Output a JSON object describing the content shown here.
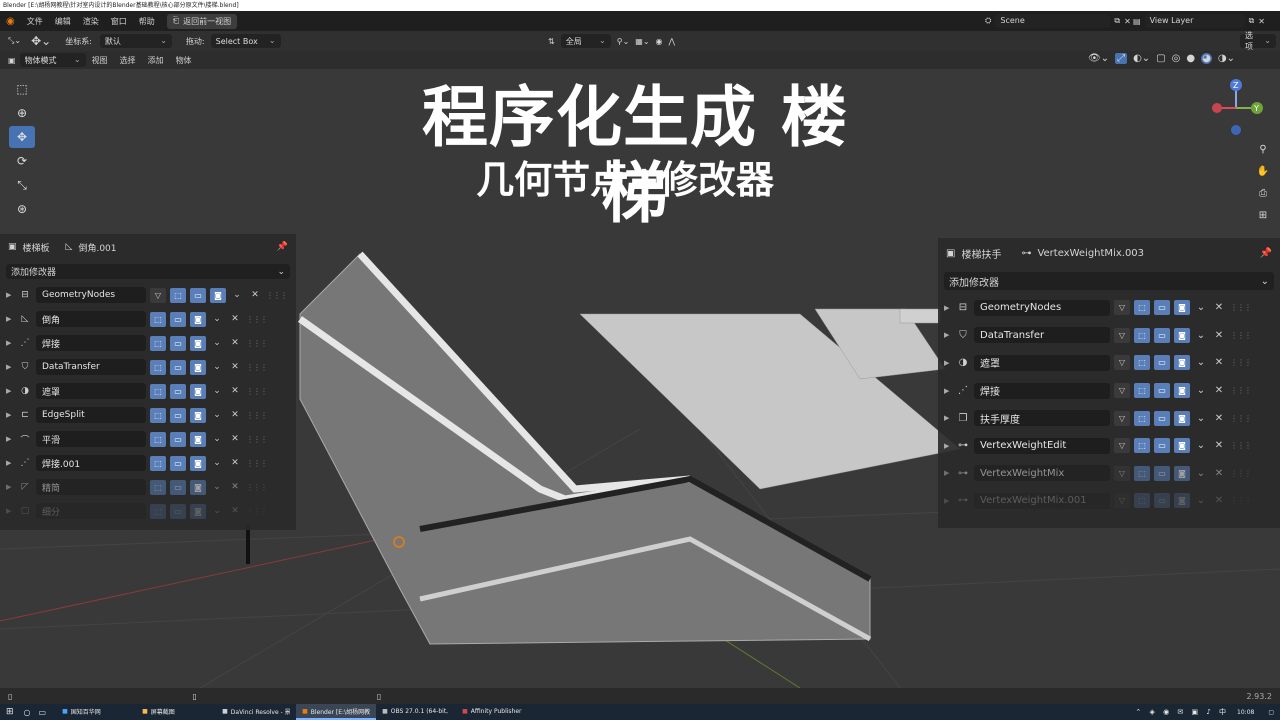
{
  "window": {
    "title": "Blender [E:\\胡杨网教程\\针对室内设计的Blender基础教程\\核心部分原文件\\楼梯.blend]"
  },
  "menu": {
    "items": [
      "文件",
      "编辑",
      "渲染",
      "窗口",
      "帮助"
    ],
    "back_button": "返回前一视图"
  },
  "scene": {
    "name": "Scene",
    "view_layer": "View Layer"
  },
  "tool_header": {
    "orientation_label": "坐标系:",
    "orientation_value": "默认",
    "drag_label": "拖动:",
    "drag_value": "Select Box",
    "pivot_value": "全局",
    "options_label": "选项"
  },
  "mode_header": {
    "mode": "物体模式",
    "menus": [
      "视图",
      "选择",
      "添加",
      "物体"
    ]
  },
  "overlay_text": {
    "title": "程序化生成 楼梯",
    "subtitle": "几何节点+修改器"
  },
  "left_panel": {
    "object_name": "楼梯板",
    "modifier_name": "倒角.001",
    "add_modifier": "添加修改器",
    "modifiers": [
      {
        "name": "GeometryNodes",
        "icon": "geometry-nodes-icon",
        "has_editmode": true
      },
      {
        "name": "倒角",
        "icon": "bevel-icon",
        "has_editmode": false
      },
      {
        "name": "焊接",
        "icon": "weld-icon",
        "has_editmode": false
      },
      {
        "name": "DataTransfer",
        "icon": "data-transfer-icon",
        "has_editmode": false
      },
      {
        "name": "遮罩",
        "icon": "mask-icon",
        "has_editmode": false
      },
      {
        "name": "EdgeSplit",
        "icon": "edge-split-icon",
        "has_editmode": false
      },
      {
        "name": "平滑",
        "icon": "smooth-icon",
        "has_editmode": false
      },
      {
        "name": "焊接.001",
        "icon": "weld-icon",
        "has_editmode": false
      },
      {
        "name": "精简",
        "icon": "decimate-icon",
        "has_editmode": false
      },
      {
        "name": "细分",
        "icon": "subdivision-icon",
        "has_editmode": false
      }
    ]
  },
  "right_panel": {
    "object_name": "楼梯扶手",
    "modifier_name": "VertexWeightMix.003",
    "add_modifier": "添加修改器",
    "modifiers": [
      {
        "name": "GeometryNodes",
        "icon": "geometry-nodes-icon"
      },
      {
        "name": "DataTransfer",
        "icon": "data-transfer-icon"
      },
      {
        "name": "遮罩",
        "icon": "mask-icon"
      },
      {
        "name": "焊接",
        "icon": "weld-icon"
      },
      {
        "name": "扶手厚度",
        "icon": "solidify-icon"
      },
      {
        "name": "VertexWeightEdit",
        "icon": "vertex-weight-icon"
      },
      {
        "name": "VertexWeightMix",
        "icon": "vertex-weight-icon"
      },
      {
        "name": "VertexWeightMix.001",
        "icon": "vertex-weight-icon"
      }
    ]
  },
  "status": {
    "version": "2.93.2"
  },
  "taskbar": {
    "tasks": [
      {
        "label": "国知百华网",
        "active": false
      },
      {
        "label": "屏幕截图",
        "active": false
      },
      {
        "label": "DaVinci Resolve - 景...",
        "active": false
      },
      {
        "label": "Blender [E:\\胡杨网教...",
        "active": true
      },
      {
        "label": "OBS 27.0.1 (64-bit, ...",
        "active": false
      },
      {
        "label": "Affinity Publisher",
        "active": false
      }
    ],
    "clock": "10:08"
  },
  "colors": {
    "accent": "#4772b3",
    "button_blue": "#5a7fb8",
    "background": "#393939"
  }
}
